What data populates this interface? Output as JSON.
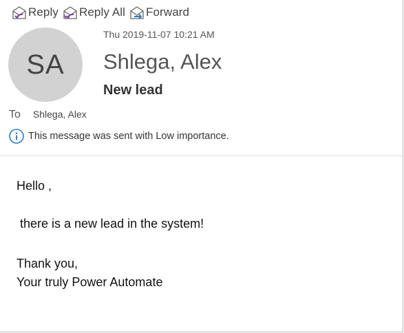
{
  "toolbar": {
    "reply": {
      "label": "Reply",
      "icon": "reply-icon"
    },
    "reply_all": {
      "label": "Reply All",
      "icon": "reply-all-icon"
    },
    "forward": {
      "label": "Forward",
      "icon": "forward-icon"
    }
  },
  "header": {
    "avatar_initials": "SA",
    "timestamp": "Thu 2019-11-07 10:21 AM",
    "sender": "Shlega, Alex",
    "subject": "New lead",
    "to_label": "To",
    "to_recipient": "Shlega, Alex",
    "importance_notice": "This message was sent with Low importance.",
    "importance_icon": "info-icon"
  },
  "body": {
    "greeting": "Hello ,",
    "line1": "there is a new lead in the system!",
    "closing": "Thank you,",
    "signature": "Your truly Power Automate"
  },
  "colors": {
    "accent_blue": "#2e7bbf",
    "icon_purple": "#7b3fa0",
    "avatar_bg": "#d2d2d2"
  }
}
